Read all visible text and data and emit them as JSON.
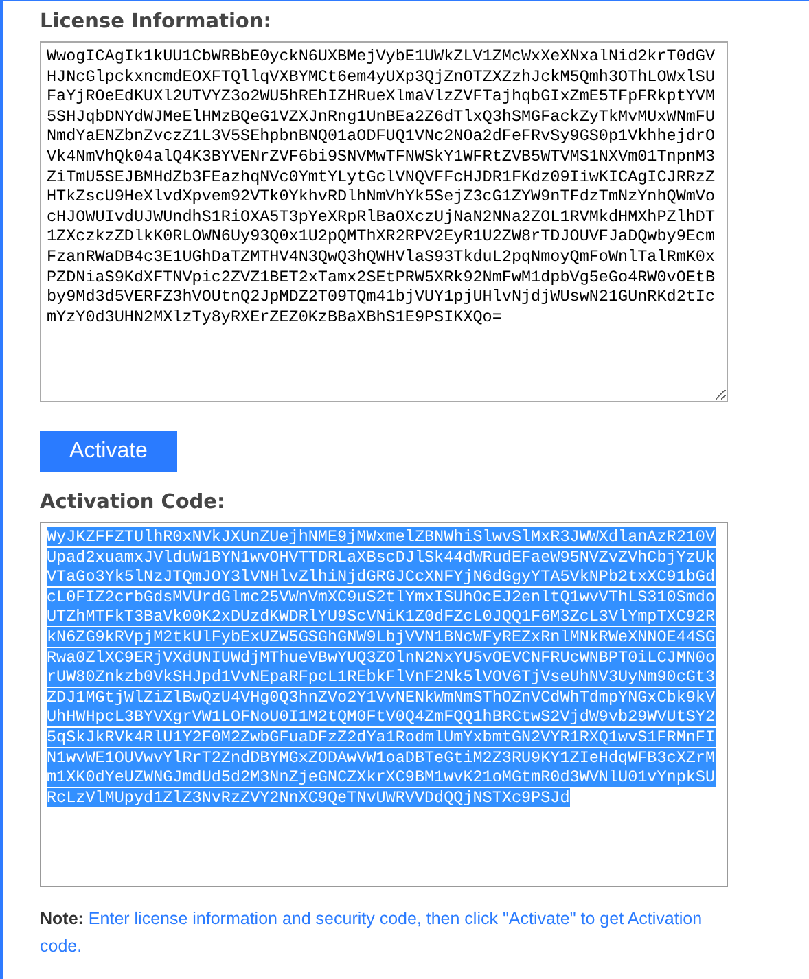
{
  "license": {
    "label": "License Information:",
    "value": "WwogICAgIk1kUU1CbWRBbE0yckN6UXBMejVybE1UWkZLV1ZMcWxXeXNxalNid2krT0dGVHJNcGlpckxncmdEOXFTQllqVXBYMCt6em4yUXp3QjZnOTZXZzhJckM5Qmh3OThLOWxlSUFaYjROeEdKUXl2UTVYZ3o2WU5hREhIZHRueXlmaVlzZVFTajhqbGIxZmE5TFpFRkptYVM5SHJqbDNYdWJMeElHMzBQeG1VZXJnRng1UnBEa2Z6dTlxQ3hSMGFackZyTkMvMUxWNmFUNmdYaENZbnZvczZ1L3V5SEhpbnBNQ01aODFUQ1VNc2NOa2dFeFRvSy9GS0p1VkhhejdrOVk4NmVhQk04alQ4K3BYVENrZVF6bi9SNVMwTFNWSkY1WFRtZVB5WTVMS1NXVm01TnpnM3ZiTmU5SEJBMHdZb3FEazhqNVc0YmtYLytGclVNQVFFcHJDR1FKdz09IiwKICAgICJRRzZHTkZscU9HeXlvdXpvem92VTk0YkhvRDlhNmVhYk5SejZ3cG1ZYW9nTFdzTmNzYnhQWmVocHJOWUIvdUJWUndhS1RiOXA5T3pYeXRpRlBaOXczUjNaN2NNa2ZOL1RVMkdHMXhPZlhDT1ZXczkzZDlkK0RLOWN6Uy93Q0x1U2pQMThXR2RPV2EyR1U2ZW8rTDJOUVFJaDQwby9EcmFzanRWaDB4c3E1UGhDaTZMTHV4N3QwQ3hQWHVlaS93TkduL2pqNmoyQmFoWnlTalRmK0xPZDNiaS9KdXFTNVpic2ZVZ1BET2xTamx2SEtPRW5XRk92NmFwM1dpbVg5eGo4RW0vOEtBby9Md3d5VERFZ3hVOUtnQ2JpMDZ2T09TQm41bjVUY1pjUHlvNjdjWUswN21GUnRKd2tIcmYzY0d3UHN2MXlzTy8yRXErZEZ0KzBBaXBhS1E9PSIKXQo="
  },
  "activate_button": "Activate",
  "activation": {
    "label": "Activation Code:",
    "selected": true,
    "value": "WyJKZFFZTUlhR0xNVkJXUnZUejhNME9jMWxmelZBNWhiSlwvSlMxR3JWWXdlanAzR210VUpad2xuamxJVlduW1BYN1wvOHVTTDRLaXBscDJlSk44dWRudEFaeW95NVZvZVhCbjYzUkVTaGo3Yk5lNzJTQmJOY3lVNHlvZlhiNjdGRGJCcXNFYjN6dGgyYTA5VkNPb2txXC91bGdcL0FIZ2crbGdsMVUrdGlmc25VWnVmXC9uS2tlYmxISUhOcEJ2enltQ1wvVThLS310SmdoUTZhMTFkT3BaVk00K2xDUzdKWDRlYU9ScVNiK1Z0dFZcL0JQQ1F6M3ZcL3VlYmpTXC92RkN6ZG9kRVpjM2tkUlFybExUZW5GSGhGNW9LbjVVN1BNcWFyREZxRnlMNkRWeXNNOE44SGRwa0ZlXC9ERjVXdUNIUWdjMThueVBwYUQ3ZOlnN2NxYU5vOEVCNFRUcWNBPT0iLCJMN0orUW80Znkzb0VkSHJpd1VvNEpaRFpcL1REbkFlVnF2Nk5lVOV6TjVseUhNV3UyNm90cGt3ZDJ1MGtjWlZiZlBwQzU4VHg0Q3hnZVo2Y1VvNENkWmNmSThOZnVCdWhTdmpYNGxCbk9kVUhHWHpcL3BYVXgrVW1LOFNoU0I1M2tQM0FtV0Q4ZmFQQ1hBRCtwS2VjdW9vb29WVUtSY25qSkJkRVk4RlU1Y2F0M2ZwbGFuaDFzZ2dYa1RodmlUmYxbmtGN2VYR1RXQ1wvS1FRMnFIN1wvWE1OUVwvYlRrT2ZndDBYMGxZODAwVW1oaDBTeGtiM2Z3RU9KY1ZIeHdqWFB3cXZrMm1XK0dYeUZWNGJmdUd5d2M3NnZjeGNCZXkrXC9BM1wvK21oMGtmR0d3WVNlU01vYnpkSURcLzVlMUpyd1ZlZ3NvRzZVY2NnXC9QeTNvUWRVVDdQQjNSTXc9PSJd"
  },
  "note": "**Note:** Enter license information and security code, then click \"Activate\" to get Activation code."
}
